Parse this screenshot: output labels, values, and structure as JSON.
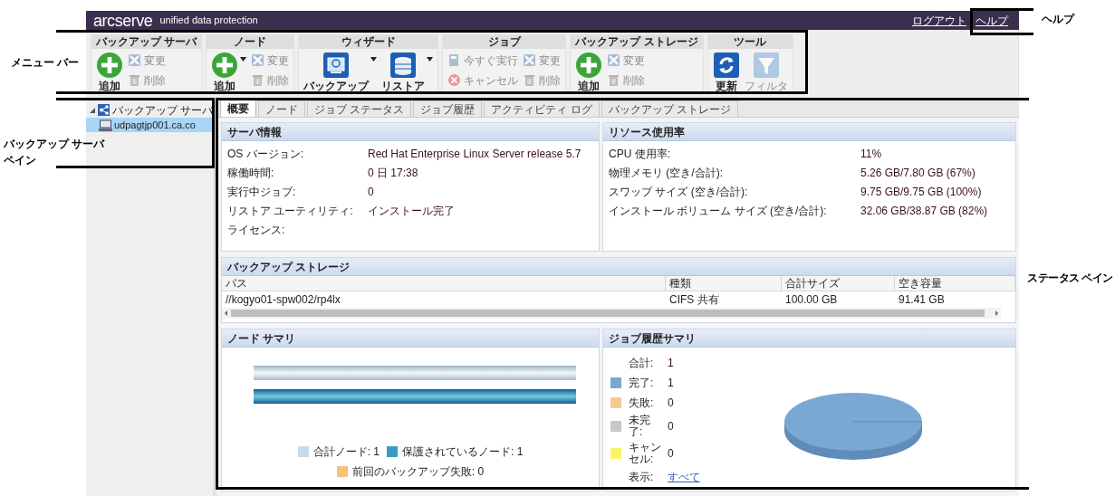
{
  "header": {
    "logo": "arcserve",
    "product": "unified data protection",
    "links": [
      "ログアウト",
      "ヘルプ"
    ]
  },
  "toolbar": [
    {
      "title": "バックアップ サーバ",
      "buttons": [
        {
          "label": "追加",
          "kind": "add",
          "disabled": false,
          "has_menu": false
        },
        {
          "label": "変更",
          "kind": "edit",
          "disabled": true,
          "has_menu": false
        },
        {
          "label": "削除",
          "kind": "delete",
          "disabled": true,
          "has_menu": false
        }
      ]
    },
    {
      "title": "ノード",
      "buttons": [
        {
          "label": "追加",
          "kind": "add",
          "disabled": false,
          "has_menu": true
        },
        {
          "label": "変更",
          "kind": "edit",
          "disabled": true,
          "has_menu": false
        },
        {
          "label": "削除",
          "kind": "delete",
          "disabled": true,
          "has_menu": false
        }
      ]
    },
    {
      "title": "ウィザード",
      "buttons": [
        {
          "label": "バックアップ",
          "kind": "backup",
          "disabled": false,
          "has_menu": true
        },
        {
          "label": "リストア",
          "kind": "restore",
          "disabled": false,
          "has_menu": true
        }
      ]
    },
    {
      "title": "ジョブ",
      "buttons": [
        {
          "label": "今すぐ実行",
          "kind": "run",
          "disabled": true,
          "has_menu": false
        },
        {
          "label": "キャンセル",
          "kind": "cancel",
          "disabled": true,
          "has_menu": false
        },
        {
          "label": "変更",
          "kind": "edit",
          "disabled": true,
          "has_menu": false
        },
        {
          "label": "削除",
          "kind": "delete",
          "disabled": true,
          "has_menu": false
        }
      ]
    },
    {
      "title": "バックアップ ストレージ",
      "buttons": [
        {
          "label": "追加",
          "kind": "add",
          "disabled": false,
          "has_menu": false
        },
        {
          "label": "変更",
          "kind": "edit",
          "disabled": true,
          "has_menu": false
        },
        {
          "label": "削除",
          "kind": "delete",
          "disabled": true,
          "has_menu": false
        }
      ]
    },
    {
      "title": "ツール",
      "buttons": [
        {
          "label": "更新",
          "kind": "refresh",
          "disabled": false,
          "has_menu": false
        },
        {
          "label": "フィルタ",
          "kind": "filter",
          "disabled": true,
          "has_menu": false
        }
      ]
    }
  ],
  "tree": {
    "label": "バックアップ サーバ",
    "expanded": true,
    "children": [
      {
        "label": "udpagtjp001.ca.co",
        "selected": true
      }
    ]
  },
  "tabs": [
    {
      "label": "概要",
      "selected": true
    },
    {
      "label": "ノード",
      "selected": false
    },
    {
      "label": "ジョブ ステータス",
      "selected": false
    },
    {
      "label": "ジョブ履歴",
      "selected": false
    },
    {
      "label": "アクティビティ ログ",
      "selected": false
    },
    {
      "label": "バックアップ ストレージ",
      "selected": false
    }
  ],
  "server_info": {
    "title": "サーバ情報",
    "rows": [
      {
        "label": "OS バージョン:",
        "value": "Red Hat Enterprise Linux Server release 5.7"
      },
      {
        "label": "稼働時間:",
        "value": "0 日 17:38"
      },
      {
        "label": "実行中ジョブ:",
        "value": "0"
      },
      {
        "label": "リストア ユーティリティ:",
        "value": "インストール完了"
      },
      {
        "label": "ライセンス:"
      }
    ]
  },
  "resource_usage": {
    "title": "リソース使用率",
    "rows": [
      {
        "label": "CPU 使用率:",
        "value": "11%"
      },
      {
        "label": "物理メモリ (空き/合計):",
        "value": "5.26 GB/7.80 GB (67%)"
      },
      {
        "label": "スワップ サイズ (空き/合計):",
        "value": "9.75 GB/9.75 GB (100%)"
      },
      {
        "label": "インストール ボリューム サイズ (空き/合計):",
        "value": "32.06 GB/38.87 GB (82%)"
      }
    ]
  },
  "backup_storage": {
    "title": "バックアップ ストレージ",
    "columns": [
      "パス",
      "種類",
      "合計サイズ",
      "空き容量"
    ],
    "rows": [
      [
        "//kogyo01-spw002/rp4lx",
        "CIFS 共有",
        "100.00 GB",
        "91.41 GB"
      ]
    ]
  },
  "node_summary": {
    "title": "ノード サマリ",
    "legend": [
      {
        "label": "合計ノード: 1",
        "color": "#c9d9e6"
      },
      {
        "label": "保護されているノード: 1",
        "color": "#3a9cc4"
      },
      {
        "label": "前回のバックアップ失敗: 0",
        "color": "#f6c27a"
      }
    ]
  },
  "job_history": {
    "title": "ジョブ履歴サマリ",
    "rows": [
      {
        "label": "合計:",
        "value": "1"
      },
      {
        "label": "完了:",
        "value": "1",
        "color": "#78a8d3"
      },
      {
        "label": "失敗:",
        "value": "0",
        "color": "#f7c98e"
      },
      {
        "label": "未完了:",
        "value": "0",
        "color": "#c4c8cb"
      },
      {
        "label": "キャンセル:",
        "value": "0",
        "color": "#f8f56a"
      }
    ],
    "view_label": "表示:",
    "view_link": "すべて"
  },
  "callouts": [
    {
      "text": "ヘルプ"
    },
    {
      "text": "メニュー バー"
    },
    {
      "text": "バックアップ サーバ"
    },
    {
      "text": "ペイン"
    },
    {
      "text": "ステータス ペイン"
    }
  ]
}
